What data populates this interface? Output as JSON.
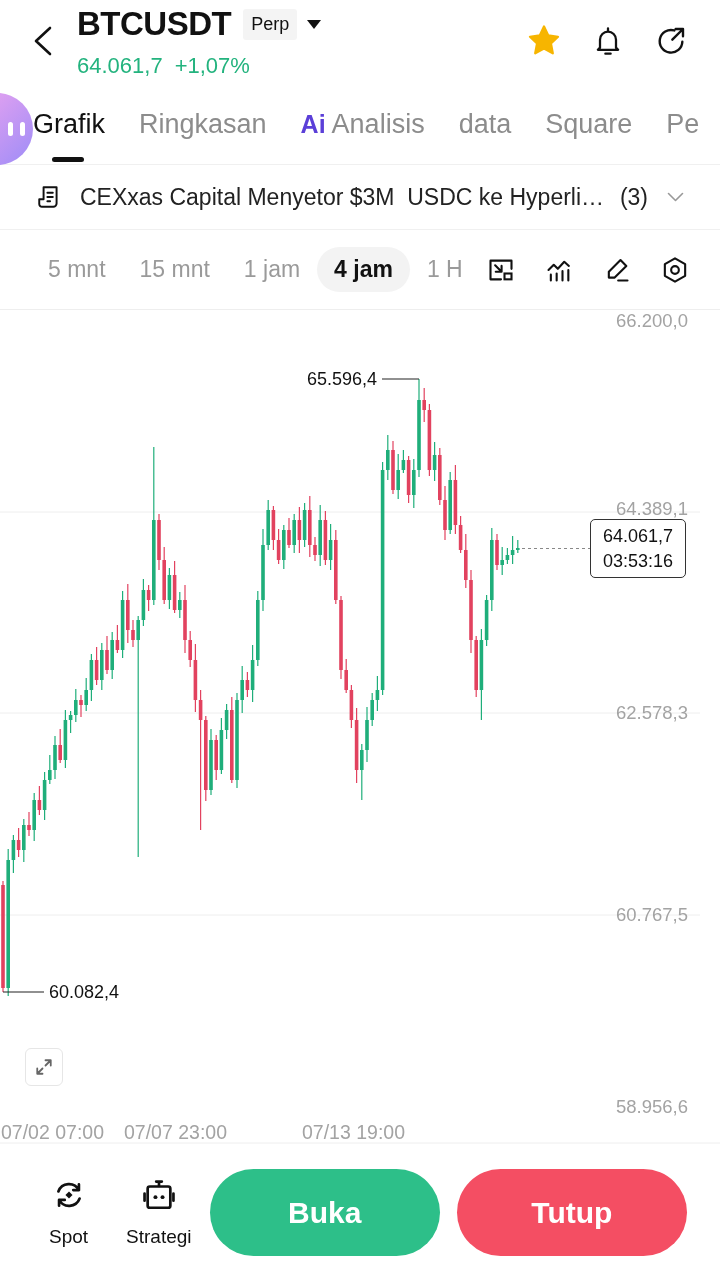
{
  "header": {
    "symbol": "BTCUSDT",
    "contract_tag": "Perp",
    "price": "64.061,7",
    "change": "+1,07%",
    "favorite": true
  },
  "tabs": [
    {
      "label": "Grafik",
      "selected": true
    },
    {
      "label": "Ringkasan",
      "selected": false
    },
    {
      "label": "Analisis",
      "badge": "Ai",
      "selected": false
    },
    {
      "label": "data",
      "selected": false
    },
    {
      "label": "Square",
      "selected": false
    },
    {
      "label": "Pe",
      "selected": false
    }
  ],
  "news": {
    "headline": "CEXxas Capital Menyetor $3M  USDC ke Hyperli…",
    "count": "(3)"
  },
  "timeframes": [
    {
      "label": "5 mnt",
      "selected": false
    },
    {
      "label": "15 mnt",
      "selected": false
    },
    {
      "label": "1 jam",
      "selected": false
    },
    {
      "label": "4 jam",
      "selected": true
    },
    {
      "label": "1 H",
      "selected": false
    }
  ],
  "chart": {
    "price_axis": [
      "66.200,0",
      "64.389,1",
      "62.578,3",
      "60.767,5",
      "58.956,6"
    ],
    "time_axis": [
      "07/02 07:00",
      "07/07 23:00",
      "07/13 19:00"
    ],
    "high_label": "65.596,4",
    "low_label": "60.082,4",
    "last_price": "64.061,7",
    "countdown": "03:53:16"
  },
  "bottom_bar": {
    "shortcuts": [
      {
        "kind": "spot",
        "label": "Spot"
      },
      {
        "kind": "strategy",
        "label": "Strategi"
      }
    ],
    "actions": [
      {
        "kind": "open",
        "label": "Buka"
      },
      {
        "kind": "close",
        "label": "Tutup"
      }
    ]
  }
}
